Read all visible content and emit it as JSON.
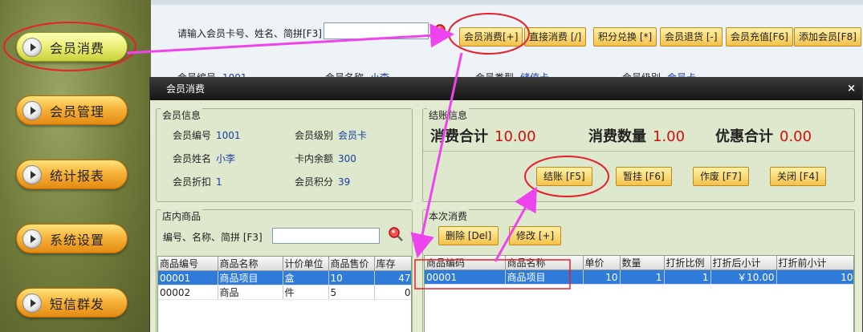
{
  "sidebar": {
    "items": [
      {
        "label": "会员消费"
      },
      {
        "label": "会员管理"
      },
      {
        "label": "统计报表"
      },
      {
        "label": "系统设置"
      },
      {
        "label": "短信群发"
      }
    ]
  },
  "topbar": {
    "search_label": "请输入会员卡号、姓名、简拼[F3]",
    "search_value": "",
    "buttons": [
      {
        "label": "会员消费[+]"
      },
      {
        "label": "直接消费 [/]"
      },
      {
        "label": "积分兑换 [*]"
      },
      {
        "label": "会员退货 [-]"
      },
      {
        "label": "会员充值[F6]"
      },
      {
        "label": "添加会员[F8]"
      }
    ],
    "info": [
      {
        "label": "会员编号",
        "value": "1001"
      },
      {
        "label": "会员名称",
        "value": "小李"
      },
      {
        "label": "会员类型",
        "value": "储值卡"
      },
      {
        "label": "会员级别",
        "value": "会员卡"
      }
    ]
  },
  "dialog": {
    "title": "会员消费",
    "close": "×",
    "member": {
      "group_title": "会员信息",
      "fields": [
        {
          "label": "会员编号",
          "value": "1001"
        },
        {
          "label": "会员级别",
          "value": "会员卡"
        },
        {
          "label": "会员姓名",
          "value": "小李"
        },
        {
          "label": "卡内余额",
          "value": "300"
        },
        {
          "label": "会员折扣",
          "value": "1"
        },
        {
          "label": "会员积分",
          "value": "39"
        }
      ]
    },
    "checkout": {
      "group_title": "结账信息",
      "total_label": "消费合计",
      "total_value": "10.00",
      "qty_label": "消费数量",
      "qty_value": "1.00",
      "discount_label": "优惠合计",
      "discount_value": "0.00",
      "buttons": [
        {
          "label": "结账 [F5]"
        },
        {
          "label": "暂挂 [F6]"
        },
        {
          "label": "作废 [F7]"
        },
        {
          "label": "关闭 [F4]"
        }
      ]
    },
    "products": {
      "group_title": "店内商品",
      "filter_label": "编号、名称、简拼 [F3]",
      "filter_value": "",
      "columns": [
        "商品编号",
        "商品名称",
        "计价单位",
        "商品售价",
        "库存"
      ],
      "rows": [
        [
          "00001",
          "商品项目",
          "盒",
          "10",
          "47"
        ],
        [
          "00002",
          "商品",
          "件",
          "5",
          "0"
        ]
      ]
    },
    "current": {
      "group_title": "本次消费",
      "delete_label": "删除 [Del]",
      "edit_label": "修改 [+]",
      "columns": [
        "商品编码",
        "商品名称",
        "单价",
        "数量",
        "打折比例",
        "打折后小计",
        "打折前小计"
      ],
      "rows": [
        [
          "00001",
          "商品项目",
          "10",
          "1",
          "1",
          "￥10.00",
          "10"
        ]
      ]
    }
  },
  "colors": {
    "annotation": "#e8202a",
    "arrow": "#ee44ee",
    "accent_button": "#f4c14b",
    "selected_row": "#2f7bd9"
  }
}
